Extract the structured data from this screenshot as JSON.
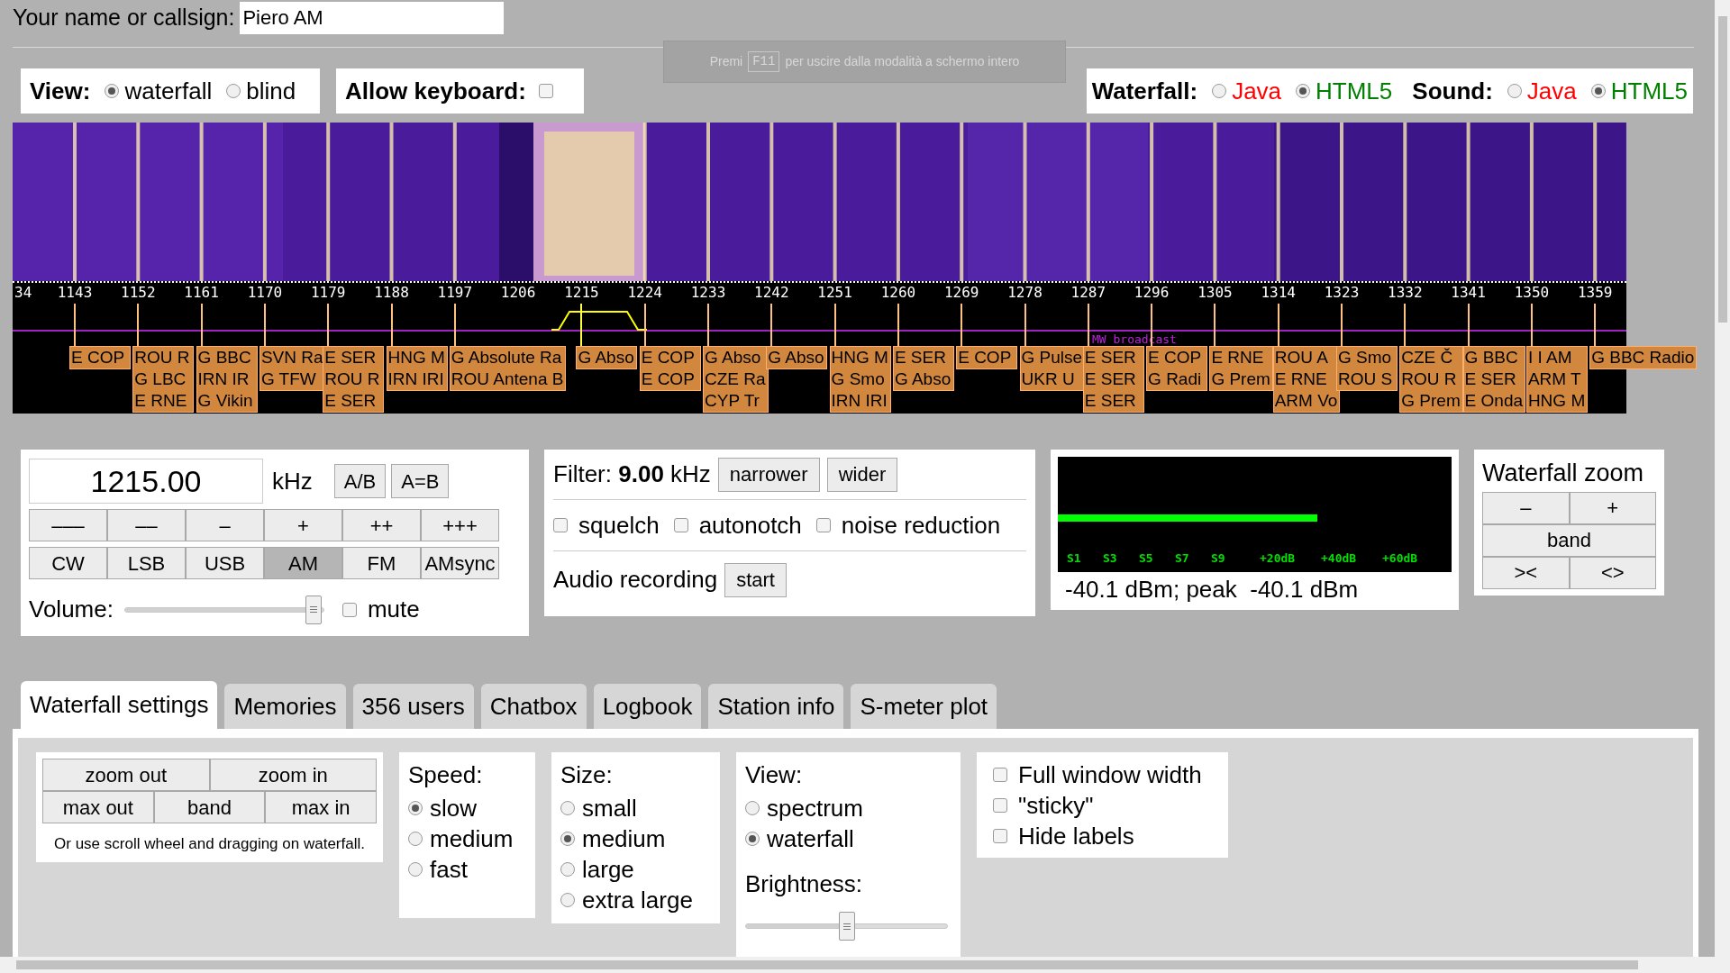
{
  "name_field": {
    "label": "Your name or callsign:",
    "value": "Piero AM"
  },
  "fullscreen_notice": {
    "before": "Premi",
    "key": "F11",
    "after": "per uscire dalla modalità a schermo intero"
  },
  "view": {
    "label": "View:",
    "options": [
      {
        "label": "waterfall",
        "selected": true
      },
      {
        "label": "blind",
        "selected": false
      }
    ]
  },
  "keyboard": {
    "label": "Allow keyboard:",
    "checked": false
  },
  "waterfall_mode": {
    "label": "Waterfall:",
    "options": [
      {
        "label": "Java",
        "selected": false,
        "color": "#ff0000"
      },
      {
        "label": "HTML5",
        "selected": true,
        "color": "#008000"
      }
    ]
  },
  "sound_mode": {
    "label": "Sound:",
    "options": [
      {
        "label": "Java",
        "selected": false,
        "color": "#ff0000"
      },
      {
        "label": "HTML5",
        "selected": true,
        "color": "#008000"
      }
    ]
  },
  "scale": {
    "band_label": "MW broadcast",
    "ticks": [
      {
        "label": "34"
      },
      {
        "label": "1143",
        "stations": [
          "E COP"
        ]
      },
      {
        "label": "1152",
        "stations": [
          "ROU R",
          "G LBC",
          "E RNE"
        ]
      },
      {
        "label": "1161",
        "stations": [
          "G BBC",
          "IRN IR",
          "G Vikin"
        ]
      },
      {
        "label": "1170",
        "stations": [
          "SVN Ra",
          "G TFW"
        ]
      },
      {
        "label": "1179",
        "stations": [
          "E SER",
          "ROU R",
          "E SER"
        ]
      },
      {
        "label": "1188",
        "stations": [
          "HNG M",
          "IRN IRI"
        ]
      },
      {
        "label": "1197",
        "stations": [
          "G Absolute Ra",
          "ROU Antena B"
        ]
      },
      {
        "label": "1206"
      },
      {
        "label": "1215",
        "stations": [
          "G Abso"
        ],
        "tuned": true
      },
      {
        "label": "1224",
        "stations": [
          "E COP",
          "E COP"
        ]
      },
      {
        "label": "1233",
        "stations": [
          "G Abso",
          "CZE Ra",
          "CYP Tr"
        ]
      },
      {
        "label": "1242",
        "stations": [
          "G Abso"
        ]
      },
      {
        "label": "1251",
        "stations": [
          "HNG M",
          "G Smo",
          "IRN IRI"
        ]
      },
      {
        "label": "1260",
        "stations": [
          "E SER",
          "G Abso"
        ]
      },
      {
        "label": "1269",
        "stations": [
          "E COP"
        ]
      },
      {
        "label": "1278",
        "stations": [
          "G Pulse",
          "UKR U"
        ]
      },
      {
        "label": "1287",
        "stations": [
          "E SER",
          "E SER",
          "E SER"
        ]
      },
      {
        "label": "1296",
        "stations": [
          "E COP",
          "G Radi"
        ]
      },
      {
        "label": "1305",
        "stations": [
          "E RNE",
          "G Prem"
        ]
      },
      {
        "label": "1314",
        "stations": [
          "ROU A",
          "E RNE",
          "ARM Vo"
        ]
      },
      {
        "label": "1323",
        "stations": [
          "G Smo",
          "ROU S"
        ]
      },
      {
        "label": "1332",
        "stations": [
          "CZE Č",
          "ROU R",
          "G Prem"
        ]
      },
      {
        "label": "1341",
        "stations": [
          "G BBC",
          "E SER",
          "E Onda"
        ]
      },
      {
        "label": "1350",
        "stations": [
          "I I AM",
          "ARM T",
          "HNG M"
        ]
      },
      {
        "label": "1359",
        "stations": [
          "G BBC Radio"
        ]
      }
    ]
  },
  "tuning": {
    "frequency": "1215.00",
    "unit": "kHz",
    "buttons": [
      "A/B",
      "A=B"
    ],
    "steps": [
      "–––",
      "––",
      "–",
      "+",
      "++",
      "+++"
    ],
    "modes": [
      {
        "label": "CW",
        "selected": false
      },
      {
        "label": "LSB",
        "selected": false
      },
      {
        "label": "USB",
        "selected": false
      },
      {
        "label": "AM",
        "selected": true
      },
      {
        "label": "FM",
        "selected": false
      },
      {
        "label": "AMsync",
        "selected": false
      }
    ],
    "volume": {
      "label": "Volume:",
      "level": 0.95
    },
    "mute": {
      "label": "mute",
      "checked": false
    }
  },
  "filter": {
    "text": "Filter: **9.00** kHz",
    "buttons": [
      "narrower",
      "wider"
    ],
    "options": [
      {
        "label": "squelch",
        "checked": false
      },
      {
        "label": "autonotch",
        "checked": false
      },
      {
        "label": "noise reduction",
        "checked": false
      }
    ],
    "recording": {
      "label": "Audio recording",
      "button": "start"
    }
  },
  "smeter": {
    "level": 0.66,
    "scale": [
      "S1",
      "S3",
      "S5",
      "S7",
      "S9",
      "+20dB",
      "+40dB",
      "+60dB"
    ],
    "reading": "-40.1 dBm; peak  -40.1 dBm"
  },
  "zoom": {
    "title": "Waterfall zoom",
    "rows": [
      [
        "–",
        "+"
      ],
      [
        "band"
      ],
      [
        "><",
        "<>"
      ]
    ]
  },
  "tabs": [
    {
      "label": "Waterfall settings",
      "selected": true
    },
    {
      "label": "Memories",
      "selected": false
    },
    {
      "label": "356 users",
      "selected": false
    },
    {
      "label": "Chatbox",
      "selected": false
    },
    {
      "label": "Logbook",
      "selected": false
    },
    {
      "label": "Station info",
      "selected": false
    },
    {
      "label": "S-meter plot",
      "selected": false
    }
  ],
  "settings": {
    "zoom_rows": [
      [
        "zoom out",
        "zoom in"
      ],
      [
        "max out",
        "band",
        "max in"
      ]
    ],
    "hint": "Or use scroll wheel and dragging on waterfall.",
    "speed": {
      "title": "Speed:",
      "options": [
        {
          "label": "slow",
          "selected": true
        },
        {
          "label": "medium",
          "selected": false
        },
        {
          "label": "fast",
          "selected": false
        }
      ]
    },
    "size": {
      "title": "Size:",
      "options": [
        {
          "label": "small",
          "selected": false
        },
        {
          "label": "medium",
          "selected": true
        },
        {
          "label": "large",
          "selected": false
        },
        {
          "label": "extra large",
          "selected": false
        }
      ]
    },
    "view": {
      "title": "View:",
      "options": [
        {
          "label": "spectrum",
          "selected": false
        },
        {
          "label": "waterfall",
          "selected": true
        }
      ]
    },
    "brightness": {
      "label": "Brightness:",
      "level": 0.5
    },
    "flags": [
      {
        "label": "Full window width",
        "checked": false
      },
      {
        "label": "\"sticky\"",
        "checked": false
      },
      {
        "label": "Hide labels",
        "checked": false
      }
    ]
  }
}
